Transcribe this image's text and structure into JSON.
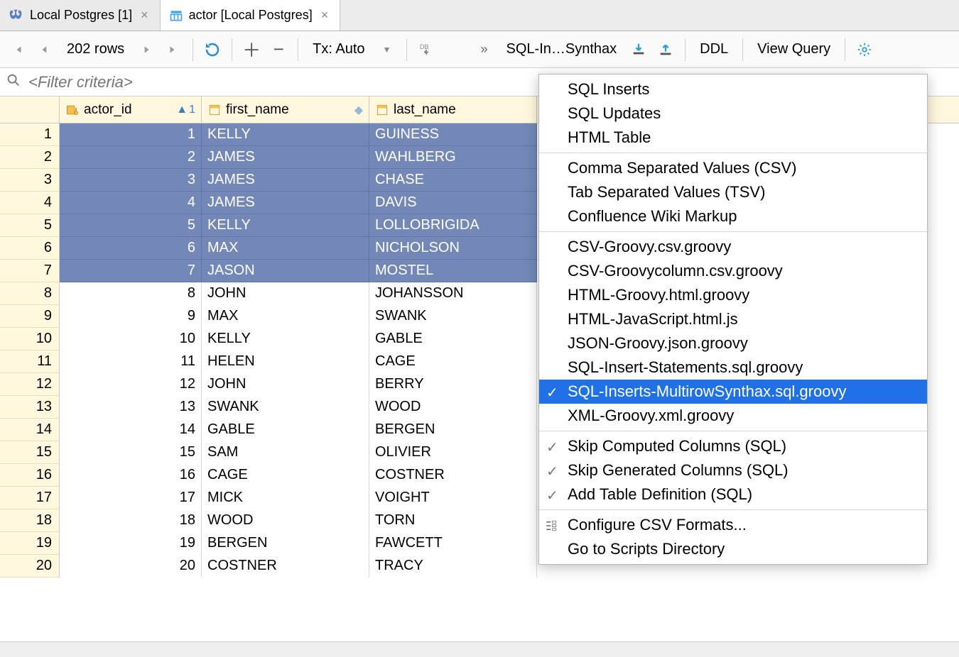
{
  "tabs": [
    {
      "label": "Local Postgres [1]",
      "active": false
    },
    {
      "label": "actor [Local Postgres]",
      "active": true
    }
  ],
  "toolbar": {
    "rows_label": "202 rows",
    "tx_label": "Tx: Auto",
    "db_label": "DB",
    "format_label": "SQL-In…Synthax",
    "ddl_label": "DDL",
    "view_query_label": "View Query"
  },
  "filter": {
    "placeholder": "<Filter criteria>"
  },
  "columns": [
    {
      "name": "actor_id",
      "sort_dir": "asc",
      "sort_index": "1",
      "pk": true
    },
    {
      "name": "first_name",
      "pk": false
    },
    {
      "name": "last_name",
      "pk": false
    }
  ],
  "rows": [
    {
      "n": 1,
      "actor_id": 1,
      "first_name": "KELLY",
      "last_name": "GUINESS",
      "selected": true
    },
    {
      "n": 2,
      "actor_id": 2,
      "first_name": "JAMES",
      "last_name": "WAHLBERG",
      "selected": true
    },
    {
      "n": 3,
      "actor_id": 3,
      "first_name": "JAMES",
      "last_name": "CHASE",
      "selected": true
    },
    {
      "n": 4,
      "actor_id": 4,
      "first_name": "JAMES",
      "last_name": "DAVIS",
      "selected": true
    },
    {
      "n": 5,
      "actor_id": 5,
      "first_name": "KELLY",
      "last_name": "LOLLOBRIGIDA",
      "selected": true
    },
    {
      "n": 6,
      "actor_id": 6,
      "first_name": "MAX",
      "last_name": "NICHOLSON",
      "selected": true
    },
    {
      "n": 7,
      "actor_id": 7,
      "first_name": "JASON",
      "last_name": "MOSTEL",
      "selected": true
    },
    {
      "n": 8,
      "actor_id": 8,
      "first_name": "JOHN",
      "last_name": "JOHANSSON",
      "selected": false
    },
    {
      "n": 9,
      "actor_id": 9,
      "first_name": "MAX",
      "last_name": "SWANK",
      "selected": false
    },
    {
      "n": 10,
      "actor_id": 10,
      "first_name": "KELLY",
      "last_name": "GABLE",
      "selected": false
    },
    {
      "n": 11,
      "actor_id": 11,
      "first_name": "HELEN",
      "last_name": "CAGE",
      "selected": false
    },
    {
      "n": 12,
      "actor_id": 12,
      "first_name": "JOHN",
      "last_name": "BERRY",
      "selected": false
    },
    {
      "n": 13,
      "actor_id": 13,
      "first_name": "SWANK",
      "last_name": "WOOD",
      "selected": false
    },
    {
      "n": 14,
      "actor_id": 14,
      "first_name": "GABLE",
      "last_name": "BERGEN",
      "selected": false
    },
    {
      "n": 15,
      "actor_id": 15,
      "first_name": "SAM",
      "last_name": "OLIVIER",
      "selected": false
    },
    {
      "n": 16,
      "actor_id": 16,
      "first_name": "CAGE",
      "last_name": "COSTNER",
      "selected": false
    },
    {
      "n": 17,
      "actor_id": 17,
      "first_name": "MICK",
      "last_name": "VOIGHT",
      "selected": false
    },
    {
      "n": 18,
      "actor_id": 18,
      "first_name": "WOOD",
      "last_name": "TORN",
      "selected": false
    },
    {
      "n": 19,
      "actor_id": 19,
      "first_name": "BERGEN",
      "last_name": "FAWCETT",
      "selected": false
    },
    {
      "n": 20,
      "actor_id": 20,
      "first_name": "COSTNER",
      "last_name": "TRACY",
      "selected": false
    }
  ],
  "popup": {
    "groups": [
      [
        {
          "label": "SQL Inserts"
        },
        {
          "label": "SQL Updates"
        },
        {
          "label": "HTML Table"
        }
      ],
      [
        {
          "label": "Comma Separated Values (CSV)"
        },
        {
          "label": "Tab Separated Values (TSV)"
        },
        {
          "label": "Confluence Wiki Markup"
        }
      ],
      [
        {
          "label": "CSV-Groovy.csv.groovy"
        },
        {
          "label": "CSV-Groovycolumn.csv.groovy"
        },
        {
          "label": "HTML-Groovy.html.groovy"
        },
        {
          "label": "HTML-JavaScript.html.js"
        },
        {
          "label": "JSON-Groovy.json.groovy"
        },
        {
          "label": "SQL-Insert-Statements.sql.groovy"
        },
        {
          "label": "SQL-Inserts-MultirowSynthax.sql.groovy",
          "checked": true,
          "highlight": true
        },
        {
          "label": "XML-Groovy.xml.groovy"
        }
      ],
      [
        {
          "label": "Skip Computed Columns (SQL)",
          "checked": true
        },
        {
          "label": "Skip Generated Columns (SQL)",
          "checked": true
        },
        {
          "label": "Add Table Definition (SQL)",
          "checked": true
        }
      ],
      [
        {
          "label": "Configure CSV Formats...",
          "icon": "config"
        },
        {
          "label": "Go to Scripts Directory"
        }
      ]
    ]
  }
}
